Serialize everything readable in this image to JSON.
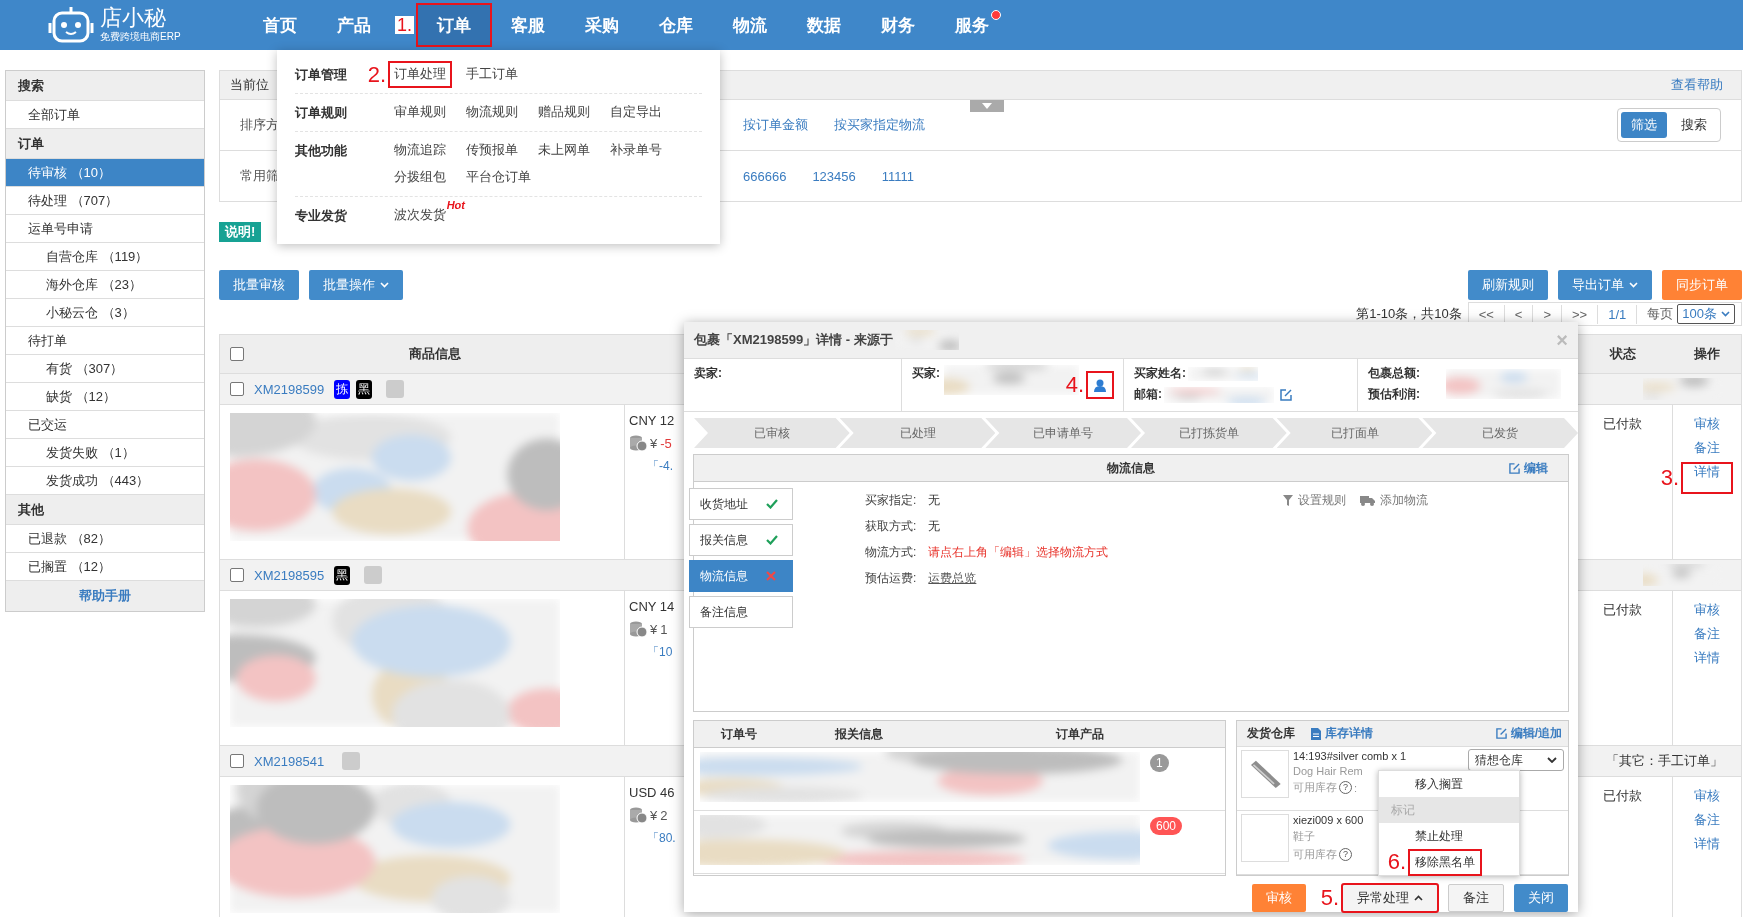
{
  "header": {
    "logo_name": "店小秘",
    "logo_tagline": "免费跨境电商ERP",
    "nav": [
      {
        "label": "首页",
        "selected": false,
        "dot": false
      },
      {
        "label": "产品",
        "selected": false,
        "dot": false
      },
      {
        "label": "订单",
        "selected": true,
        "dot": false,
        "annotation": "1."
      },
      {
        "label": "客服",
        "selected": false,
        "dot": false
      },
      {
        "label": "采购",
        "selected": false,
        "dot": false
      },
      {
        "label": "仓库",
        "selected": false,
        "dot": false
      },
      {
        "label": "物流",
        "selected": false,
        "dot": false
      },
      {
        "label": "数据",
        "selected": false,
        "dot": false
      },
      {
        "label": "财务",
        "selected": false,
        "dot": false
      },
      {
        "label": "服务",
        "selected": false,
        "dot": true
      }
    ]
  },
  "sidebar": {
    "sections": [
      {
        "title": "搜索",
        "items": [
          {
            "label": "全部订单",
            "selected": false
          }
        ]
      },
      {
        "title": "订单",
        "items": [
          {
            "label": "待审核 （10）",
            "selected": true
          },
          {
            "label": "待处理 （707）",
            "selected": false
          },
          {
            "label": "运单号申请",
            "selected": false,
            "children": [
              {
                "label": "自营仓库 （119）",
                "selected": false
              },
              {
                "label": "海外仓库 （23）",
                "selected": false
              },
              {
                "label": "小秘云仓 （3）",
                "selected": false
              }
            ]
          },
          {
            "label": "待打单",
            "selected": false,
            "children": [
              {
                "label": "有货 （307）",
                "selected": false
              },
              {
                "label": "缺货 （12）",
                "selected": false
              }
            ]
          },
          {
            "label": "已交运",
            "selected": false,
            "children": [
              {
                "label": "发货失败 （1）",
                "selected": false
              },
              {
                "label": "发货成功 （443）",
                "selected": false
              }
            ]
          }
        ]
      },
      {
        "title": "其他",
        "items": [
          {
            "label": "已退款 （82）",
            "selected": false
          },
          {
            "label": "已搁置 （12）",
            "selected": false
          }
        ]
      }
    ],
    "footer": "帮助手册"
  },
  "breadcrumb": {
    "label": "当前位",
    "help": "查看帮助"
  },
  "filters": {
    "sort_label": "排序方",
    "sort_options": [
      "按订单金额",
      "按买家指定物流"
    ],
    "common_label": "常用筛",
    "common_options": [
      "666666",
      "123456",
      "11111"
    ],
    "modes": [
      {
        "label": "筛选",
        "selected": true
      },
      {
        "label": "搜索",
        "selected": false
      }
    ]
  },
  "notice": "说明!",
  "actions_left": [
    {
      "label": "批量审核",
      "dropdown": false,
      "kind": "primary"
    },
    {
      "label": "批量操作",
      "dropdown": true,
      "kind": "primary"
    }
  ],
  "actions_right": [
    {
      "label": "刷新规则",
      "dropdown": false,
      "kind": "primary"
    },
    {
      "label": "导出订单",
      "dropdown": true,
      "kind": "primary"
    },
    {
      "label": "同步订单",
      "dropdown": false,
      "kind": "warning"
    }
  ],
  "pagination": {
    "summary": "第1-10条，共10条",
    "buttons": [
      "<<",
      "<",
      ">",
      ">>"
    ],
    "page": "1/1",
    "per_page_label": "每页",
    "per_page": "100条"
  },
  "table": {
    "select_all_checked": false,
    "columns": [
      "商品信息",
      "状态",
      "操作"
    ],
    "orders": [
      {
        "id": "XM2198599",
        "checked": false,
        "tags": [
          {
            "label": "拣",
            "color": "#0000ff"
          },
          {
            "label": "黑",
            "color": "#000000"
          }
        ],
        "amount": "CNY 12",
        "currency": "¥",
        "profit": "-5",
        "profit_negative": true,
        "note": "「-4.",
        "status": "已付款",
        "actions": [
          {
            "label": "审核"
          },
          {
            "label": "备注"
          },
          {
            "label": "详情",
            "annotation": "3."
          }
        ]
      },
      {
        "id": "XM2198595",
        "checked": false,
        "tags": [
          {
            "label": "黑",
            "color": "#000000"
          }
        ],
        "amount": "CNY 14",
        "currency": "¥",
        "profit": "1",
        "profit_negative": false,
        "note": "「10",
        "status": "已付款",
        "actions": [
          {
            "label": "审核"
          },
          {
            "label": "备注"
          },
          {
            "label": "详情"
          }
        ]
      },
      {
        "id": "XM2198541",
        "checked": false,
        "source": "「其它：手工订单」",
        "amount": "USD 46",
        "currency": "¥",
        "profit": "2",
        "profit_negative": false,
        "note": "「80.",
        "status": "已付款",
        "actions": [
          {
            "label": "审核"
          },
          {
            "label": "备注"
          },
          {
            "label": "详情"
          }
        ]
      }
    ]
  },
  "order_menu": {
    "groups": [
      {
        "title": "订单管理",
        "items": [
          {
            "label": "订单处理",
            "annotation": "2."
          },
          {
            "label": "手工订单"
          }
        ]
      },
      {
        "title": "订单规则",
        "items": [
          {
            "label": "审单规则"
          },
          {
            "label": "物流规则"
          },
          {
            "label": "赠品规则"
          },
          {
            "label": "自定导出"
          }
        ]
      },
      {
        "title": "其他功能",
        "items": [
          {
            "label": "物流追踪"
          },
          {
            "label": "传预报单"
          },
          {
            "label": "未上网单"
          },
          {
            "label": "补录单号"
          },
          {
            "label": "分拨组包"
          },
          {
            "label": "平台仓订单"
          }
        ]
      },
      {
        "title": "专业发货",
        "items": [
          {
            "label": "波次发货",
            "badge": "Hot"
          }
        ]
      }
    ]
  },
  "detail": {
    "title": "包裹「XM2198599」详情 - 来源于",
    "close": "×",
    "seller_label": "卖家:",
    "buyer_label": "买家:",
    "buyer_annotation": "4.",
    "buyer_name_label": "买家姓名:",
    "email_label": "邮箱:",
    "total_label": "包裹总额:",
    "profit_label": "预估利润:",
    "steps": [
      "已审核",
      "已处理",
      "已申请单号",
      "已打拣货单",
      "已打面单",
      "已发货"
    ],
    "panel_title": "物流信息",
    "edit": "编辑",
    "tabs": [
      {
        "label": "收货地址",
        "kind": "done",
        "selected": false
      },
      {
        "label": "报关信息",
        "kind": "done",
        "selected": false
      },
      {
        "label": "物流信息",
        "kind": "error",
        "selected": true
      },
      {
        "label": "备注信息",
        "kind": "plain",
        "selected": false
      }
    ],
    "fields": [
      {
        "label": "买家指定:",
        "value": "无",
        "kind": "text"
      },
      {
        "label": "获取方式:",
        "value": "无",
        "kind": "text"
      },
      {
        "label": "物流方式:",
        "value": "请点右上角「编辑」选择物流方式",
        "kind": "warning"
      },
      {
        "label": "预估运费:",
        "value": "运费总览",
        "kind": "link"
      }
    ],
    "tools": [
      {
        "label": "设置规则"
      },
      {
        "label": "添加物流"
      }
    ],
    "orders_table": {
      "columns": [
        "订单号",
        "报关信息",
        "订单产品"
      ],
      "rows": [
        {
          "badge": "1",
          "kind": "count"
        },
        {
          "badge": "600",
          "kind": "alert"
        }
      ]
    },
    "warehouse": {
      "title": "发货仓库",
      "stock_link": "库存详情",
      "edit_link": "编辑/追加",
      "items": [
        {
          "name": "14:193#silver comb x 1",
          "subtitle": "Dog Hair Rem",
          "stock_label": "可用库存",
          "stock_hint": "?",
          "stock_suffix": ":",
          "warehouse": "猜想仓库",
          "kind": "picture"
        },
        {
          "name": "xiezi009 x 600",
          "subtitle": "鞋子",
          "stock_label": "可用库存",
          "stock_hint": "?",
          "kind": "empty"
        }
      ]
    },
    "context_menu": [
      {
        "label": "移入搁置",
        "kind": "action"
      },
      {
        "label": "标记",
        "kind": "header"
      },
      {
        "label": "禁止处理",
        "kind": "action"
      },
      {
        "label": "移除黑名单",
        "kind": "action",
        "annotation": "6."
      }
    ],
    "footer_buttons": [
      {
        "label": "审核",
        "kind": "warning"
      },
      {
        "label": "异常处理",
        "kind": "default",
        "caret": true,
        "annotation": "5."
      },
      {
        "label": "备注",
        "kind": "default"
      },
      {
        "label": "关闭",
        "kind": "primary"
      }
    ]
  }
}
